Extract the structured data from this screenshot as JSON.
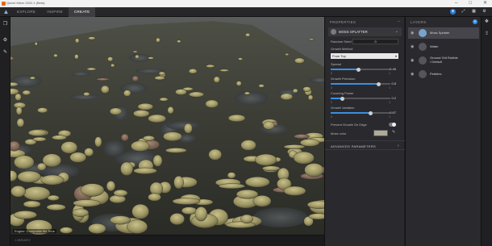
{
  "window": {
    "title": "Quixel Mixer 2022.1 (Beta)"
  },
  "topbar": {
    "tabs": [
      {
        "label": "EXPLORE"
      },
      {
        "label": "INSPIRE"
      },
      {
        "label": "CREATE"
      }
    ]
  },
  "viewport": {
    "label": "Engine: Composite Ms Tone"
  },
  "library": {
    "label": "LIBRARY"
  },
  "properties": {
    "title": "PROPERTIES",
    "module_name": "MOSS SPLATTER",
    "random_seed_label": "Random Seed",
    "random_seed_value": "0",
    "growth_method_label": "Growth Method",
    "growth_method_value": "From Top",
    "spread_label": "Spread",
    "spread_value": "0.46",
    "spread_min": "0",
    "spread_max": "1",
    "spread_fraction": 0.46,
    "growth_precision_label": "Growth Precision",
    "growth_precision_value": "0.8",
    "growth_precision_min": "0",
    "growth_precision_max": "1",
    "growth_precision_fraction": 0.8,
    "covering_power_label": "Covering Power",
    "covering_power_value": "0.2",
    "covering_power_min": "0",
    "covering_power_max": "1",
    "covering_power_fraction": 0.2,
    "growth_variation_label": "Growth Variation",
    "growth_variation_value": "0.67",
    "growth_variation_min": "0",
    "growth_variation_max": "1",
    "growth_variation_fraction": 0.67,
    "prevent_growth_label": "Prevent Growth On Edge",
    "prevent_growth_on": true,
    "moss_color_label": "Moss color",
    "moss_color": "#b0aa98",
    "advanced_label": "ADVANCED PARAMETERS"
  },
  "layers": {
    "title": "LAYERS",
    "items": [
      {
        "name": "Moss Splatter",
        "selected": true
      },
      {
        "name": "Water",
        "selected": false
      },
      {
        "name": "Ground Grit Rubble / Default",
        "selected": false
      },
      {
        "name": "Pebbles",
        "selected": false
      }
    ]
  },
  "colors": {
    "accent": "#3b8fe0",
    "active_tab": "#3d3d42",
    "panel": "#2a2a2e"
  }
}
